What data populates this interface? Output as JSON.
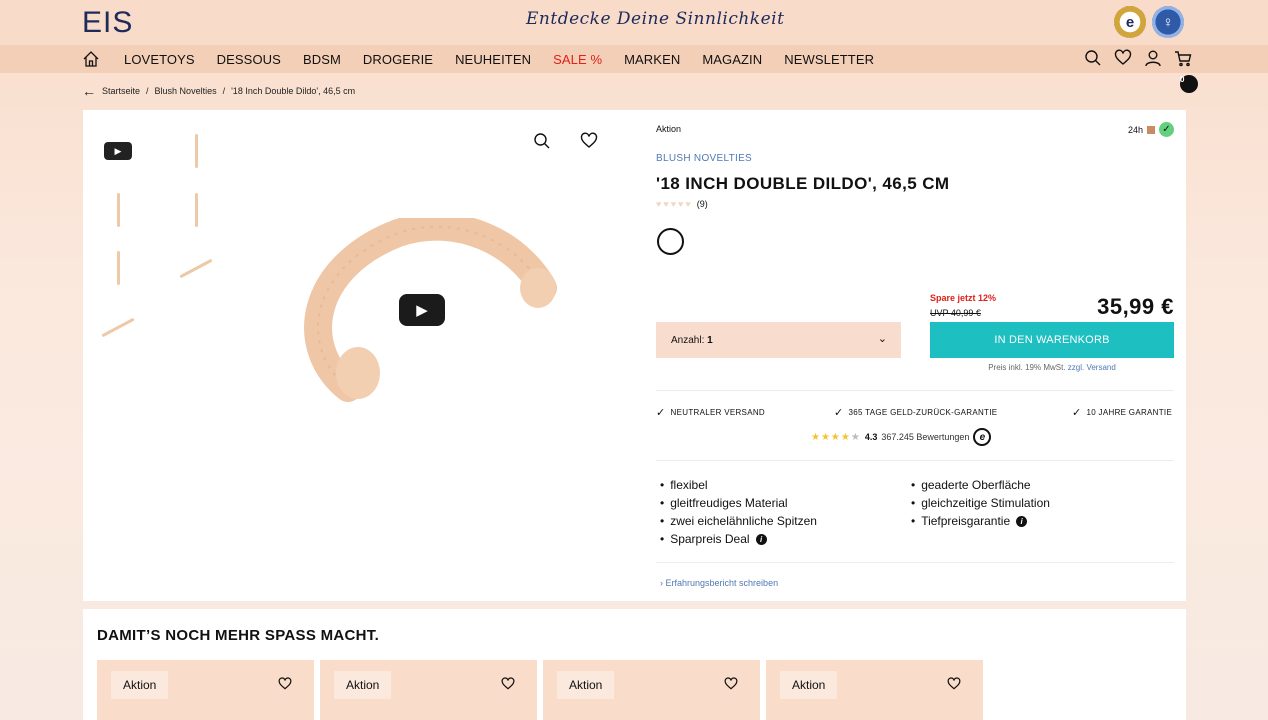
{
  "header": {
    "logo": "EIS",
    "tagline": "Entdecke Deine Sinnlichkeit",
    "badges": [
      "trusted-shops-badge",
      "seal-badge"
    ]
  },
  "nav": {
    "items": [
      {
        "label": "LOVETOYS"
      },
      {
        "label": "DESSOUS"
      },
      {
        "label": "BDSM"
      },
      {
        "label": "DROGERIE"
      },
      {
        "label": "NEUHEITEN"
      },
      {
        "label": "SALE %"
      },
      {
        "label": "MARKEN"
      },
      {
        "label": "MAGAZIN"
      },
      {
        "label": "NEWSLETTER"
      }
    ],
    "cart_count": "0",
    "sale_color": "#e0201a"
  },
  "breadcrumb": {
    "items": [
      "Startseite",
      "Blush Novelties",
      "'18 Inch Double Dildo', 46,5 cm"
    ]
  },
  "product": {
    "aktion_label": "Aktion",
    "availability": "24h",
    "brand": "BLUSH NOVELTIES",
    "title": "'18 INCH DOUBLE DILDO', 46,5 CM",
    "rating_hearts": 4.5,
    "review_count": "(9)",
    "save_text": "Spare jetzt 12%",
    "uvp_text": "UVP 40,99 €",
    "price": "35,99 €",
    "quantity_label": "Anzahl:",
    "quantity_value": "1",
    "add_to_cart": "IN DEN WARENKORB",
    "vat_note": "Preis inkl. 19% MwSt.",
    "shipping_link": "zzgl. Versand",
    "accent_color": "#1dbfc0"
  },
  "trust": {
    "items": [
      "NEUTRALER VERSAND",
      "365 TAGE GELD-ZURÜCK-GARANTIE",
      "10 JAHRE GARANTIE"
    ],
    "rating_score": "4.3",
    "rating_count": "367.245 Bewertungen",
    "stars": 4.3
  },
  "features": {
    "left": [
      "flexibel",
      "gleitfreudiges Material",
      "zwei eichelähnliche Spitzen",
      "Sparpreis Deal"
    ],
    "right": [
      "geaderte Oberfläche",
      "gleichzeitige Stimulation",
      "Tiefpreisgarantie"
    ]
  },
  "review_link": "Erfahrungsbericht schreiben",
  "recommendations": {
    "heading": "DAMIT’S NOCH MEHR SPASS MACHT.",
    "tiles": [
      {
        "tag": "Aktion"
      },
      {
        "tag": "Aktion"
      },
      {
        "tag": "Aktion"
      },
      {
        "tag": "Aktion"
      }
    ]
  }
}
